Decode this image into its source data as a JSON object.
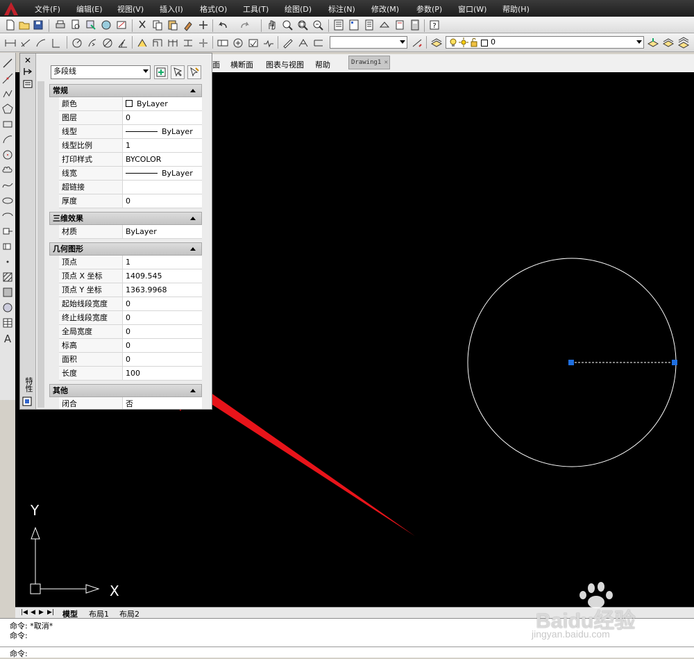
{
  "menu": {
    "items": [
      "文件(F)",
      "编辑(E)",
      "视图(V)",
      "插入(I)",
      "格式(O)",
      "工具(T)",
      "绘图(D)",
      "标注(N)",
      "修改(M)",
      "参数(P)",
      "窗口(W)",
      "帮助(H)"
    ]
  },
  "toolbar": {
    "layer_value": "0"
  },
  "tabs": {
    "menus": [
      "面",
      "横断面",
      "图表与视图",
      "帮助"
    ],
    "document": "Drawing1"
  },
  "palette": {
    "object_type": "多段线",
    "side_label": "特性",
    "sections": {
      "general": {
        "title": "常规",
        "rows": [
          {
            "key": "颜色",
            "value": "ByLayer"
          },
          {
            "key": "图层",
            "value": "0"
          },
          {
            "key": "线型",
            "value": "ByLayer"
          },
          {
            "key": "线型比例",
            "value": "1"
          },
          {
            "key": "打印样式",
            "value": "BYCOLOR"
          },
          {
            "key": "线宽",
            "value": "ByLayer"
          },
          {
            "key": "超链接",
            "value": ""
          },
          {
            "key": "厚度",
            "value": "0"
          }
        ]
      },
      "effects3d": {
        "title": "三维效果",
        "rows": [
          {
            "key": "材质",
            "value": "ByLayer"
          }
        ]
      },
      "geometry": {
        "title": "几何图形",
        "rows": [
          {
            "key": "顶点",
            "value": "1"
          },
          {
            "key": "顶点 X 坐标",
            "value": "1409.545"
          },
          {
            "key": "顶点 Y 坐标",
            "value": "1363.9968"
          },
          {
            "key": "起始线段宽度",
            "value": "0"
          },
          {
            "key": "终止线段宽度",
            "value": "0"
          },
          {
            "key": "全局宽度",
            "value": "0"
          },
          {
            "key": "标高",
            "value": "0"
          },
          {
            "key": "面积",
            "value": "0"
          },
          {
            "key": "长度",
            "value": "100"
          }
        ]
      },
      "misc": {
        "title": "其他",
        "rows": [
          {
            "key": "闭合",
            "value": "否"
          }
        ]
      }
    }
  },
  "ucs": {
    "x_label": "X",
    "y_label": "Y"
  },
  "layout_tabs": [
    "模型",
    "布局1",
    "布局2"
  ],
  "command": {
    "history": [
      "命令: *取消*",
      "命令:"
    ],
    "prompt": "命令:"
  },
  "watermark": {
    "brand": "Baidu经验",
    "url": "jingyan.baidu.com"
  },
  "colors": {
    "canvas": "#000000",
    "grip": "#1f6fe0",
    "arrow": "#e8141a"
  }
}
